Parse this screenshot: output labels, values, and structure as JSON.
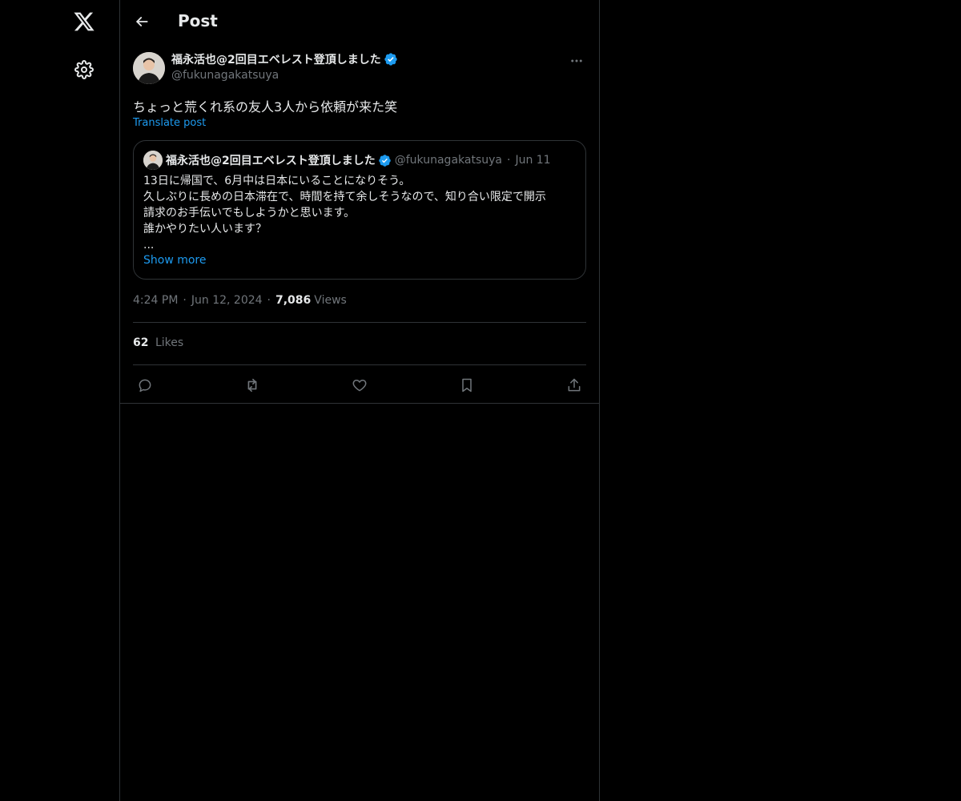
{
  "header": {
    "title": "Post"
  },
  "post": {
    "author": {
      "display_name": "福永活也@2回目エベレスト登頂しました",
      "handle": "@fukunagakatsuya"
    },
    "text": "ちょっと荒くれ系の友人3人から依頼が来た笑",
    "translate_label": "Translate post",
    "quote": {
      "display_name": "福永活也@2回目エベレスト登頂しました",
      "handle": "@fukunagakatsuya",
      "date": "Jun 11",
      "lines": [
        "13日に帰国で、6月中は日本にいることになりそう。",
        "久しぶりに長めの日本滞在で、時間を持て余しそうなので、知り合い限定で開示",
        "請求のお手伝いでもしようかと思います。",
        "誰かやりたい人います？",
        "..."
      ],
      "show_more_label": "Show more"
    },
    "time": "4:24 PM",
    "date": "Jun 12, 2024",
    "views_count": "7,086",
    "views_label": "Views",
    "likes_count": "62",
    "likes_label": "Likes"
  },
  "colors": {
    "background": "#000000",
    "text": "#e7e9ea",
    "secondary": "#71767b",
    "accent": "#1d9bf0",
    "border": "#2f3336"
  },
  "icons": {
    "sidebar": [
      "x-logo-icon",
      "settings-gear-icon"
    ],
    "header": [
      "back-arrow-icon"
    ],
    "actions": [
      "reply-icon",
      "retweet-icon",
      "like-heart-icon",
      "bookmark-icon",
      "share-icon"
    ]
  }
}
